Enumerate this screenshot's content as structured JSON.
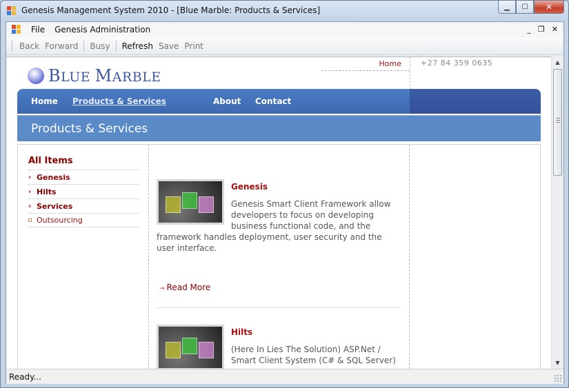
{
  "window": {
    "title": "Genesis Management System 2010 - [Blue Marble: Products & Services]",
    "buttons": {
      "minimize": "▁",
      "maximize": "☐",
      "close": "✕"
    }
  },
  "menu": {
    "items": [
      "File",
      "Genesis Administration"
    ],
    "mdi": {
      "minimize": "_",
      "restore": "❐",
      "close": "✕"
    }
  },
  "toolbar": {
    "back": "Back",
    "forward": "Forward",
    "busy": "Busy",
    "refresh": "Refresh",
    "save": "Save",
    "print": "Print"
  },
  "site": {
    "logo_first": "B",
    "logo_lue": "LUE ",
    "logo_m": "M",
    "logo_arble": "ARBLE",
    "home_link": "Home",
    "phone": "+27 84 359 0635",
    "nav": [
      "Home",
      "Products & Services",
      "About",
      "Contact"
    ],
    "banner_title": "Products & Services"
  },
  "sidebar": {
    "title": "All Items",
    "items": [
      "Genesis",
      "Hilts",
      "Services",
      "Outsourcing"
    ]
  },
  "products": [
    {
      "title": "Genesis",
      "desc_indent": "Genesis Smart Client Framework allow developers to focus on developing business functional code, and the",
      "desc_rest": "framework handles deployment, user security and the user interface.",
      "read_more": "Read More"
    },
    {
      "title": "Hilts",
      "desc_indent": "(Here In Lies The Solution) ASP.Net / Smart Client System (C# & SQL Server)"
    }
  ],
  "status": {
    "text": "Ready..."
  },
  "colors": {
    "accent_red": "#a31010",
    "nav_blue": "#4a7cc4",
    "banner_blue": "#5b8ac9",
    "logo_blue": "#3f56a8"
  },
  "icons": {
    "app": "app-icon",
    "menu": "app-menu-icon",
    "scroll_up": "scroll-up-icon",
    "scroll_down": "scroll-down-icon"
  }
}
